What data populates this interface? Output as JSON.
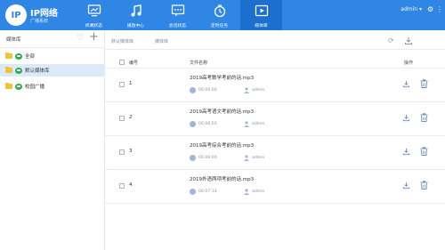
{
  "app": {
    "logo_text": "IP",
    "title": "IP网络",
    "subtitle": "广播系统"
  },
  "nav": [
    {
      "label": "终端状态",
      "icon": "monitor-icon"
    },
    {
      "label": "播放中心",
      "icon": "music-icon"
    },
    {
      "label": "会话状态",
      "icon": "chat-icon"
    },
    {
      "label": "定时任务",
      "icon": "timer-icon"
    },
    {
      "label": "媒体库",
      "icon": "media-play-icon",
      "active": true
    }
  ],
  "user": {
    "name": "admin ▾"
  },
  "sidebar": {
    "title": "媒体库",
    "items": [
      {
        "label": "全部"
      },
      {
        "label": "默认媒体库",
        "active": true
      },
      {
        "label": "校园广播"
      }
    ]
  },
  "main": {
    "breadcrumb": [
      "默认媒体库",
      "媒体库"
    ],
    "columns": {
      "num": "编号",
      "name": "文件名称",
      "op": "操作"
    },
    "rows": [
      {
        "num": "1",
        "name": "2019高考数学考前的话.mp3",
        "duration": "00:06:00",
        "user": "admin"
      },
      {
        "num": "2",
        "name": "2019高考语文考前的话.mp3",
        "duration": "00:06:03",
        "user": "admin"
      },
      {
        "num": "3",
        "name": "2019高考综合考前的话.mp3",
        "duration": "00:06:00",
        "user": "admin"
      },
      {
        "num": "4",
        "name": "2019外语两项考前的话.mp3",
        "duration": "00:07:14",
        "user": "admin"
      }
    ]
  },
  "colors": {
    "topbar": "#2f86e5",
    "nav_active": "#1c6fcf",
    "sidebar_active": "#dce9f8",
    "folder": "#f0c13b",
    "group": "#2cae45"
  }
}
